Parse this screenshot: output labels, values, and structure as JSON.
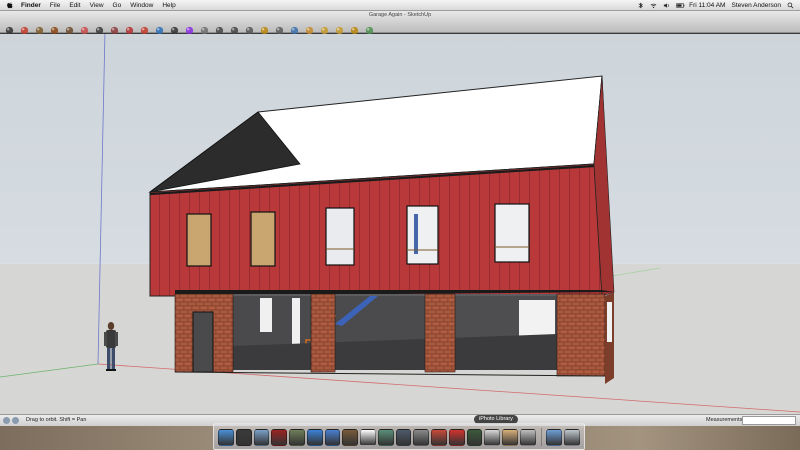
{
  "menubar": {
    "app": "Finder",
    "menus": [
      "Finder",
      "File",
      "Edit",
      "View",
      "Go",
      "Window",
      "Help"
    ],
    "clock": "Fri 11:04 AM",
    "user": "Steven Anderson"
  },
  "window": {
    "title": "Garage Again - SketchUp"
  },
  "toolbar": {
    "tools": [
      {
        "icon": "select-arrow-icon",
        "color": "#333333"
      },
      {
        "icon": "pencil-icon",
        "color": "#c0392b"
      },
      {
        "icon": "rectangle-icon",
        "color": "#7a5a2a"
      },
      {
        "icon": "circle-icon",
        "color": "#8b4513"
      },
      {
        "icon": "polygon-icon",
        "color": "#6b4a2a"
      },
      {
        "icon": "eraser-icon",
        "color": "#c74b4b"
      },
      {
        "icon": "paint-bucket-icon",
        "color": "#3a3a3a"
      },
      {
        "icon": "push-pull-icon",
        "color": "#8b3a3a"
      },
      {
        "icon": "move-icon",
        "color": "#b03030"
      },
      {
        "icon": "rotate-icon",
        "color": "#c0392b"
      },
      {
        "icon": "offset-icon",
        "color": "#2c6fb5"
      },
      {
        "icon": "tape-measure-icon",
        "color": "#333333"
      },
      {
        "icon": "orbit-icon",
        "color": "#8a2be2"
      },
      {
        "icon": "pan-icon",
        "color": "#6f6f6f"
      },
      {
        "icon": "zoom-icon",
        "color": "#444444"
      },
      {
        "icon": "zoom-extents-icon",
        "color": "#444444"
      },
      {
        "icon": "previous-view-icon",
        "color": "#555555"
      },
      {
        "icon": "position-camera-icon",
        "color": "#b8860b"
      },
      {
        "icon": "walk-icon",
        "color": "#5a5a5a"
      },
      {
        "icon": "look-around-icon",
        "color": "#3b6eaa"
      },
      {
        "icon": "section-plane-icon",
        "color": "#c48a2b"
      },
      {
        "icon": "get-models-icon",
        "color": "#c49a2b"
      },
      {
        "icon": "share-model-icon",
        "color": "#c49a2b"
      },
      {
        "icon": "components-icon",
        "color": "#b8860b"
      },
      {
        "icon": "extensions-icon",
        "color": "#4f8f4f"
      }
    ]
  },
  "statusbar": {
    "hint": "Drag to orbit. Shift = Pan",
    "measurements_label": "Measurements",
    "measurements_value": ""
  },
  "dock": {
    "tooltip": "iPhoto Library",
    "apps": [
      {
        "icon": "finder-icon",
        "color": "#4b8fd6"
      },
      {
        "icon": "dashboard-icon",
        "color": "#3a3a3a"
      },
      {
        "icon": "mail-icon",
        "color": "#7aa0c8"
      },
      {
        "icon": "photo-booth-icon",
        "color": "#9b2222"
      },
      {
        "icon": "photo-icon",
        "color": "#6f7f5a"
      },
      {
        "icon": "safari-icon",
        "color": "#3b82d6"
      },
      {
        "icon": "itunes-icon",
        "color": "#4a7fd0"
      },
      {
        "icon": "address-book-icon",
        "color": "#7a5a3a"
      },
      {
        "icon": "ical-icon",
        "color": "#ffffff"
      },
      {
        "icon": "iphoto-icon",
        "color": "#5a8f7a"
      },
      {
        "icon": "time-machine-icon",
        "color": "#4d5a6a"
      },
      {
        "icon": "system-preferences-icon",
        "color": "#8a8a8a"
      },
      {
        "icon": "textedit-icon",
        "color": "#c84a3a"
      },
      {
        "icon": "sketchup-icon",
        "color": "#d0332e"
      },
      {
        "icon": "photo-viewer-icon",
        "color": "#3a5a3a"
      },
      {
        "icon": "pdf-icon",
        "color": "#d8d8d8"
      },
      {
        "icon": "pages-icon",
        "color": "#d8b07a"
      },
      {
        "icon": "preview-icon",
        "color": "#c0c0c0"
      },
      {
        "icon": "downloads-folder-icon",
        "color": "#6f9fd6"
      },
      {
        "icon": "trash-icon",
        "color": "#bfc6cc"
      }
    ]
  }
}
